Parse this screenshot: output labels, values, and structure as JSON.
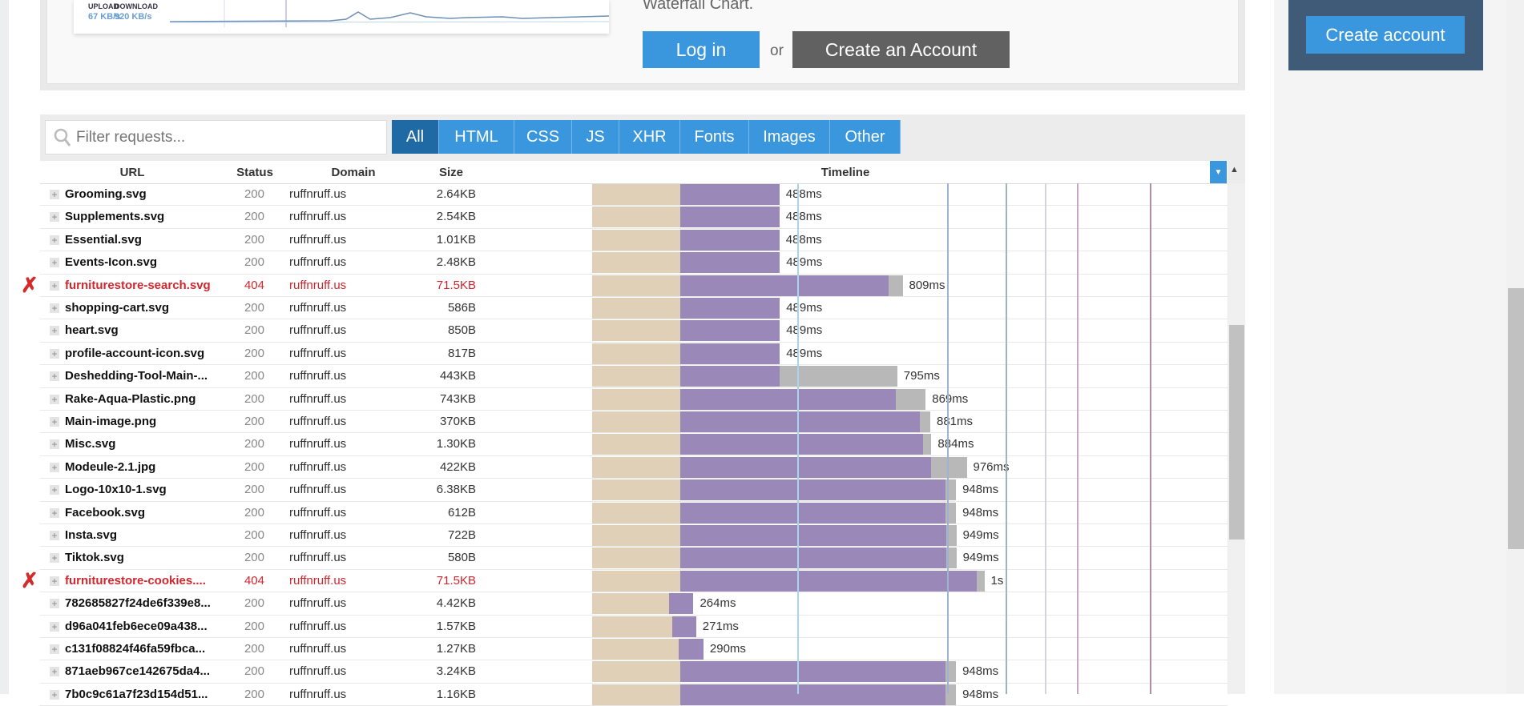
{
  "top": {
    "upload_label": "UPLOAD",
    "upload_value": "67 KB/s",
    "download_label": "DOWNLOAD",
    "download_value": "920 KB/s",
    "waterfall_text": "Waterfall Chart.",
    "login_label": "Log in",
    "or_label": "or",
    "create_label": "Create an Account"
  },
  "sidebar": {
    "create_account_label": "Create account"
  },
  "filter": {
    "placeholder": "Filter requests..."
  },
  "tabs": [
    {
      "label": "All",
      "active": true
    },
    {
      "label": "HTML"
    },
    {
      "label": "CSS"
    },
    {
      "label": "JS"
    },
    {
      "label": "XHR"
    },
    {
      "label": "Fonts"
    },
    {
      "label": "Images"
    },
    {
      "label": "Other"
    }
  ],
  "columns": {
    "url": "URL",
    "status": "Status",
    "domain": "Domain",
    "size": "Size",
    "timeline": "Timeline"
  },
  "colors": {
    "wait": "#e0d0b8",
    "receive": "#9a89b8",
    "other": "#b8b8b8",
    "error": "#d0262d",
    "accent": "#3a97dd"
  },
  "timeline_markers_ms": [
    {
      "ms": 534,
      "color": "#a8d4ef"
    },
    {
      "ms": 924,
      "color": "#9fb3d1"
    },
    {
      "ms": 1078,
      "color": "#9db5b8"
    },
    {
      "ms": 1180,
      "color": "#d4d4dc"
    },
    {
      "ms": 1263,
      "color": "#c9a3c0"
    },
    {
      "ms": 1453,
      "color": "#b48aa8"
    }
  ],
  "rows": [
    {
      "name": "Grooming.svg",
      "status": "200",
      "domain": "ruffnruff.us",
      "size": "2.64KB",
      "time": "488ms",
      "phases": [
        230,
        258,
        0
      ]
    },
    {
      "name": "Supplements.svg",
      "status": "200",
      "domain": "ruffnruff.us",
      "size": "2.54KB",
      "time": "488ms",
      "phases": [
        230,
        258,
        0
      ]
    },
    {
      "name": "Essential.svg",
      "status": "200",
      "domain": "ruffnruff.us",
      "size": "1.01KB",
      "time": "488ms",
      "phases": [
        230,
        258,
        0
      ]
    },
    {
      "name": "Events-Icon.svg",
      "status": "200",
      "domain": "ruffnruff.us",
      "size": "2.48KB",
      "time": "489ms",
      "phases": [
        230,
        259,
        0
      ]
    },
    {
      "name": "furniturestore-search.svg",
      "status": "404",
      "domain": "ruffnruff.us",
      "size": "71.5KB",
      "time": "809ms",
      "phases": [
        230,
        542,
        37
      ],
      "error": true
    },
    {
      "name": "shopping-cart.svg",
      "status": "200",
      "domain": "ruffnruff.us",
      "size": "586B",
      "time": "489ms",
      "phases": [
        230,
        259,
        0
      ]
    },
    {
      "name": "heart.svg",
      "status": "200",
      "domain": "ruffnruff.us",
      "size": "850B",
      "time": "489ms",
      "phases": [
        230,
        259,
        0
      ]
    },
    {
      "name": "profile-account-icon.svg",
      "status": "200",
      "domain": "ruffnruff.us",
      "size": "817B",
      "time": "489ms",
      "phases": [
        230,
        259,
        0
      ]
    },
    {
      "name": "Deshedding-Tool-Main-...",
      "status": "200",
      "domain": "ruffnruff.us",
      "size": "443KB",
      "time": "795ms",
      "phases": [
        230,
        259,
        306
      ]
    },
    {
      "name": "Rake-Aqua-Plastic.png",
      "status": "200",
      "domain": "ruffnruff.us",
      "size": "743KB",
      "time": "869ms",
      "phases": [
        230,
        562,
        77
      ]
    },
    {
      "name": "Main-image.png",
      "status": "200",
      "domain": "ruffnruff.us",
      "size": "370KB",
      "time": "881ms",
      "phases": [
        230,
        623,
        28
      ]
    },
    {
      "name": "Misc.svg",
      "status": "200",
      "domain": "ruffnruff.us",
      "size": "1.30KB",
      "time": "884ms",
      "phases": [
        230,
        632,
        22
      ]
    },
    {
      "name": "Modeule-2.1.jpg",
      "status": "200",
      "domain": "ruffnruff.us",
      "size": "422KB",
      "time": "976ms",
      "phases": [
        230,
        653,
        93
      ]
    },
    {
      "name": "Logo-10x10-1.svg",
      "status": "200",
      "domain": "ruffnruff.us",
      "size": "6.38KB",
      "time": "948ms",
      "phases": [
        230,
        691,
        27
      ]
    },
    {
      "name": "Facebook.svg",
      "status": "200",
      "domain": "ruffnruff.us",
      "size": "612B",
      "time": "948ms",
      "phases": [
        230,
        691,
        27
      ]
    },
    {
      "name": "Insta.svg",
      "status": "200",
      "domain": "ruffnruff.us",
      "size": "722B",
      "time": "949ms",
      "phases": [
        230,
        692,
        27
      ]
    },
    {
      "name": "Tiktok.svg",
      "status": "200",
      "domain": "ruffnruff.us",
      "size": "580B",
      "time": "949ms",
      "phases": [
        230,
        692,
        27
      ]
    },
    {
      "name": "furniturestore-cookies....",
      "status": "404",
      "domain": "ruffnruff.us",
      "size": "71.5KB",
      "time": "1s",
      "phases": [
        230,
        772,
        20
      ],
      "error": true
    },
    {
      "name": "782685827f24de6f339e8...",
      "status": "200",
      "domain": "ruffnruff.us",
      "size": "4.42KB",
      "time": "264ms",
      "phases": [
        200,
        64,
        0
      ]
    },
    {
      "name": "d96a041feb6ece09a438...",
      "status": "200",
      "domain": "ruffnruff.us",
      "size": "1.57KB",
      "time": "271ms",
      "phases": [
        208,
        63,
        0
      ]
    },
    {
      "name": "c131f08824f46fa59fbca...",
      "status": "200",
      "domain": "ruffnruff.us",
      "size": "1.27KB",
      "time": "290ms",
      "phases": [
        225,
        65,
        0
      ]
    },
    {
      "name": "871aeb967ce142675da4...",
      "status": "200",
      "domain": "ruffnruff.us",
      "size": "3.24KB",
      "time": "948ms",
      "phases": [
        230,
        691,
        27
      ]
    },
    {
      "name": "7b0c9c61a7f23d154d51...",
      "status": "200",
      "domain": "ruffnruff.us",
      "size": "1.16KB",
      "time": "948ms",
      "phases": [
        230,
        691,
        27
      ]
    }
  ]
}
